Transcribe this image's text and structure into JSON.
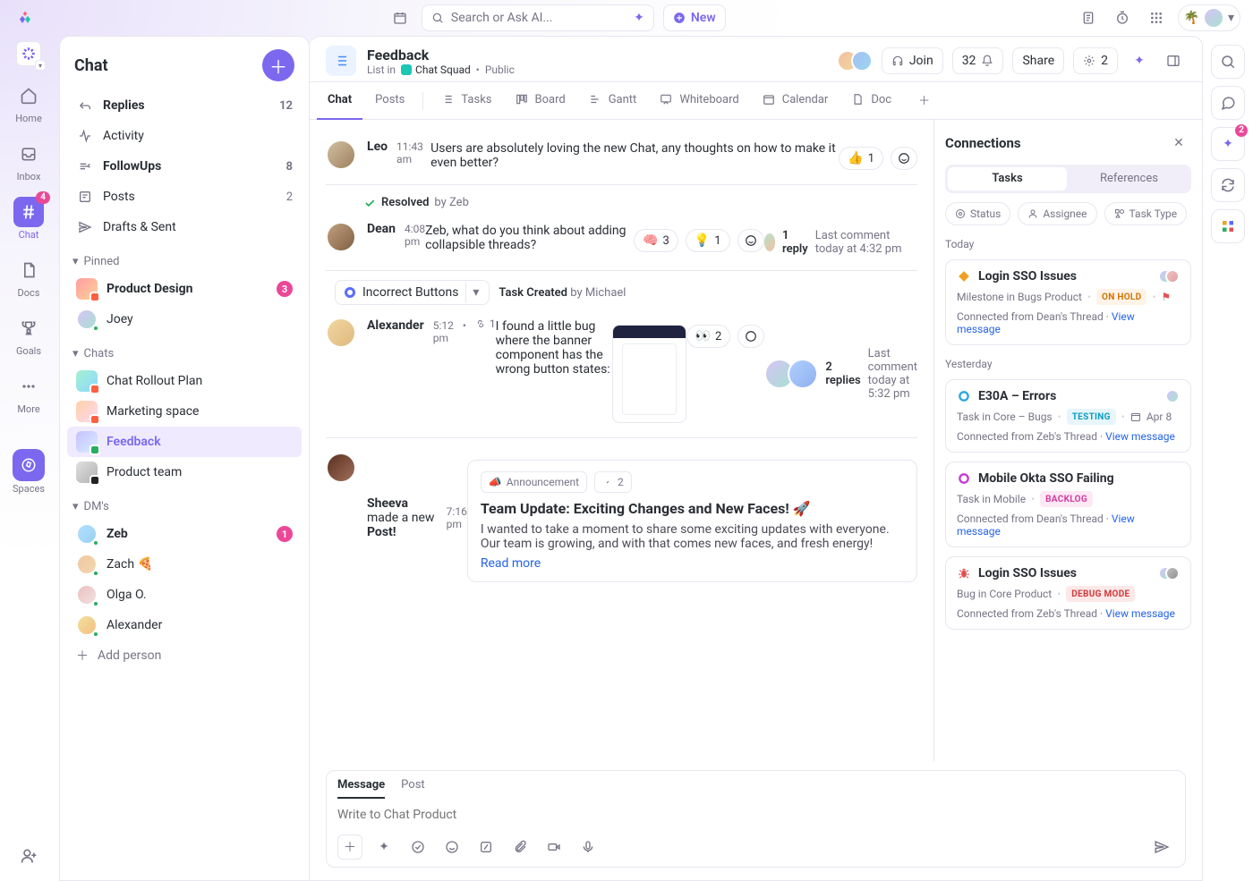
{
  "topbar": {
    "search_placeholder": "Search or Ask AI...",
    "new_label": "New"
  },
  "rail": {
    "items": [
      {
        "id": "home",
        "label": "Home"
      },
      {
        "id": "inbox",
        "label": "Inbox"
      },
      {
        "id": "chat",
        "label": "Chat",
        "badge": "4",
        "active": true
      },
      {
        "id": "docs",
        "label": "Docs"
      },
      {
        "id": "goals",
        "label": "Goals"
      },
      {
        "id": "more",
        "label": "More"
      }
    ],
    "spaces_label": "Spaces"
  },
  "chatnav": {
    "title": "Chat",
    "primary": [
      {
        "id": "replies",
        "label": "Replies",
        "count": "12",
        "bold": true
      },
      {
        "id": "activity",
        "label": "Activity"
      },
      {
        "id": "followups",
        "label": "FollowUps",
        "count": "8",
        "bold": true
      },
      {
        "id": "posts",
        "label": "Posts",
        "count": "2"
      },
      {
        "id": "drafts",
        "label": "Drafts & Sent"
      }
    ],
    "pinned_label": "Pinned",
    "pinned": [
      {
        "id": "product-design",
        "label": "Product Design",
        "badge": "3",
        "bold": true
      },
      {
        "id": "joey",
        "label": "Joey",
        "presence": true
      }
    ],
    "chats_label": "Chats",
    "chats": [
      {
        "id": "rollout",
        "label": "Chat Rollout Plan"
      },
      {
        "id": "marketing",
        "label": "Marketing space"
      },
      {
        "id": "feedback",
        "label": "Feedback",
        "active": true
      },
      {
        "id": "product-team",
        "label": "Product team"
      }
    ],
    "dms_label": "DM's",
    "dms": [
      {
        "id": "zeb",
        "label": "Zeb",
        "bold": true,
        "badge": "1",
        "presence": true
      },
      {
        "id": "zach",
        "label": "Zach",
        "emoji": "🍕",
        "presence": true
      },
      {
        "id": "olga",
        "label": "Olga O.",
        "presence": true
      },
      {
        "id": "alex",
        "label": "Alexander",
        "presence": true
      }
    ],
    "add_person": "Add person"
  },
  "header": {
    "title": "Feedback",
    "breadcrumb_prefix": "List in",
    "space_name": "Chat Squad",
    "visibility": "Public",
    "join_label": "Join",
    "member_count": "32",
    "share_label": "Share",
    "automations_count": "2"
  },
  "views": [
    {
      "id": "chat",
      "label": "Chat",
      "active": true
    },
    {
      "id": "posts",
      "label": "Posts"
    },
    {
      "id": "tasks",
      "label": "Tasks"
    },
    {
      "id": "board",
      "label": "Board"
    },
    {
      "id": "gantt",
      "label": "Gantt"
    },
    {
      "id": "whiteboard",
      "label": "Whiteboard"
    },
    {
      "id": "calendar",
      "label": "Calendar"
    },
    {
      "id": "doc",
      "label": "Doc"
    }
  ],
  "messages": {
    "leo": {
      "name": "Leo",
      "time": "11:43 am",
      "text": "Users are absolutely loving the new Chat, any thoughts on how to make it even better?",
      "reactions": [
        {
          "emoji": "👍",
          "count": "1"
        }
      ]
    },
    "resolved": {
      "prefix": "Resolved",
      "by": "by Zeb"
    },
    "dean": {
      "name": "Dean",
      "time": "4:08 pm",
      "text": "Zeb, what do you think about adding collapsible threads?",
      "reactions": [
        {
          "emoji": "🧠",
          "count": "3"
        },
        {
          "emoji": "💡",
          "count": "1"
        }
      ],
      "replies_count": "1 reply",
      "replies_meta": "Last comment today at 4:32 pm"
    },
    "task_chip": {
      "label": "Incorrect Buttons",
      "status_prefix": "Task Created",
      "by": "by Michael"
    },
    "alex": {
      "name": "Alexander",
      "time": "5:12 pm",
      "conn_count": "1",
      "text": "I found a little bug where the banner component has the wrong button states:",
      "reactions": [
        {
          "emoji": "👀",
          "count": "2"
        }
      ],
      "replies_count": "2 replies",
      "replies_meta": "Last comment today at 5:32 pm"
    },
    "sheeva": {
      "name": "Sheeva",
      "made_label": "made a new",
      "post_label": "Post!",
      "time": "7:16 pm",
      "announcement_label": "Announcement",
      "ann_count": "2",
      "title": "Team Update: Exciting Changes and New Faces! 🚀",
      "body": "I wanted to take a moment to share some exciting updates with everyone. Our team is growing, and with that comes new faces, and fresh energy!",
      "read_more": "Read more"
    }
  },
  "composer": {
    "tab_message": "Message",
    "tab_post": "Post",
    "placeholder": "Write to Chat Product"
  },
  "connections": {
    "title": "Connections",
    "seg_tasks": "Tasks",
    "seg_refs": "References",
    "filters": [
      {
        "id": "status",
        "label": "Status"
      },
      {
        "id": "assignee",
        "label": "Assignee"
      },
      {
        "id": "tasktype",
        "label": "Task Type"
      }
    ],
    "groups": {
      "today": {
        "label": "Today",
        "cards": [
          {
            "icon": "diamond",
            "icon_color": "#f0a020",
            "title": "Login SSO Issues",
            "sub": "Milestone in Bugs Product",
            "status": "ON HOLD",
            "status_class": "c-onhold",
            "flag": true,
            "avatars": 2,
            "foot_from": "Connected from Dean's Thread",
            "foot_link": "View message"
          }
        ]
      },
      "yesterday": {
        "label": "Yesterday",
        "cards": [
          {
            "icon": "ring",
            "icon_color": "#2aa7d9",
            "title": "E30A – Errors",
            "sub": "Task in Core – Bugs",
            "status": "TESTING",
            "status_class": "c-testing",
            "date": "Apr 8",
            "avatars": 1,
            "foot_from": "Connected from Zeb's Thread",
            "foot_link": "View message"
          },
          {
            "icon": "ring",
            "icon_color": "#c43bd6",
            "title": "Mobile Okta SSO Failing",
            "sub": "Task in Mobile",
            "status": "BACKLOG",
            "status_class": "c-backlog",
            "avatars": 0,
            "foot_from": "Connected from Dean's Thread",
            "foot_link": "View message"
          },
          {
            "icon": "bug",
            "icon_color": "#e25050",
            "title": "Login SSO Issues",
            "sub": "Bug in Core Product",
            "status": "DEBUG MODE",
            "status_class": "c-debug",
            "avatars": 2,
            "foot_from": "Connected from Zeb's Thread",
            "foot_link": "View message"
          }
        ]
      }
    }
  },
  "right_rail": {
    "ai_badge": "2"
  }
}
